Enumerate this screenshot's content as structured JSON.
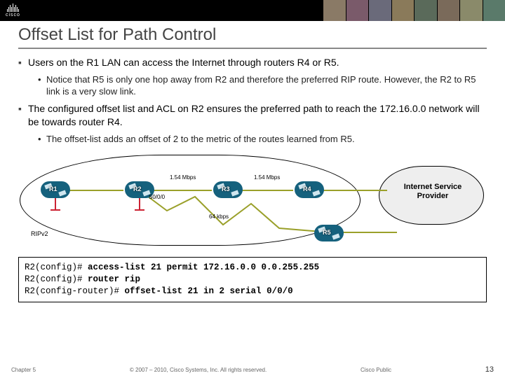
{
  "header": {
    "brand": "cisco"
  },
  "title": "Offset List for Path Control",
  "bullets": {
    "b1": "Users on the R1 LAN can access the Internet through routers R4 or R5.",
    "b1a": "Notice that R5 is only one hop away from R2 and therefore the preferred RIP route. However, the R2 to R5 link is a very slow link.",
    "b2": "The configured offset list and ACL on R2 ensures the preferred path to reach the 172.16.0.0 network will be towards router R4.",
    "b2a": "The offset-list adds an offset of 2 to the metric of the routes learned from R5."
  },
  "diagram": {
    "routers": {
      "r1": "R1",
      "r2": "R2",
      "r3": "R3",
      "r4": "R4",
      "r5": "R5"
    },
    "links": {
      "r2_r3": "1.54 Mbps",
      "r3_r4": "1.54 Mbps",
      "r2_r5": "64 kbps",
      "r2_if": "S0/0/0"
    },
    "domain_label": "RIPv2",
    "isp_label": "Internet Service Provider"
  },
  "config": {
    "line1_prompt": "R2(config)# ",
    "line1_cmd": "access-list 21 permit 172.16.0.0 0.0.255.255",
    "line2_prompt": "R2(config)# ",
    "line2_cmd": "router rip",
    "line3_prompt": "R2(config-router)# ",
    "line3_cmd": "offset-list 21 in 2 serial 0/0/0"
  },
  "footer": {
    "chapter": "Chapter 5",
    "copyright": "© 2007 – 2010, Cisco Systems, Inc. All rights reserved.",
    "classification": "Cisco Public",
    "page": "13"
  }
}
